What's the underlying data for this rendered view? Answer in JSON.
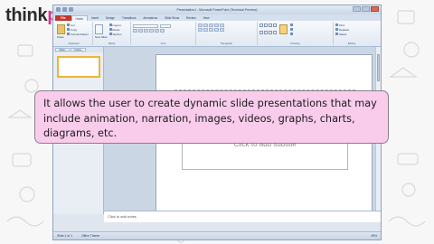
{
  "brand": {
    "think": "think",
    "pad": "pad"
  },
  "window": {
    "title": "Presentation1 - Microsoft PowerPoint (Technical Preview)",
    "tabs": [
      "File",
      "Home",
      "Insert",
      "Design",
      "Transitions",
      "Animations",
      "Slide Show",
      "Review",
      "View"
    ],
    "active_tab": "Home",
    "groups": {
      "clipboard": "Clipboard",
      "slides": "Slides",
      "font": "Font",
      "paragraph": "Paragraph",
      "drawing": "Drawing",
      "editing": "Editing"
    },
    "ribbon": {
      "paste": "Paste",
      "cut": "Cut",
      "copy": "Copy",
      "format_painter": "Format Painter",
      "new_slide": "New Slide",
      "layout": "Layout",
      "reset": "Reset",
      "section": "Section",
      "find": "Find",
      "replace": "Replace",
      "select": "Select"
    },
    "pane_tabs": [
      "Slides",
      "Outline"
    ],
    "subtitle_placeholder": "Click to add subtitle",
    "notes_placeholder": "Click to add notes",
    "status": {
      "slide": "Slide 1 of 1",
      "theme": "Office Theme",
      "zoom": "49%"
    }
  },
  "caption": "It allows the user to create dynamic slide presentations that may include animation, narration, images, videos, graphs, charts, diagrams, etc.",
  "colors": {
    "brand_pink": "#e2308f",
    "callout_fill": "#f9ccec",
    "file_tab": "#c0392b"
  }
}
